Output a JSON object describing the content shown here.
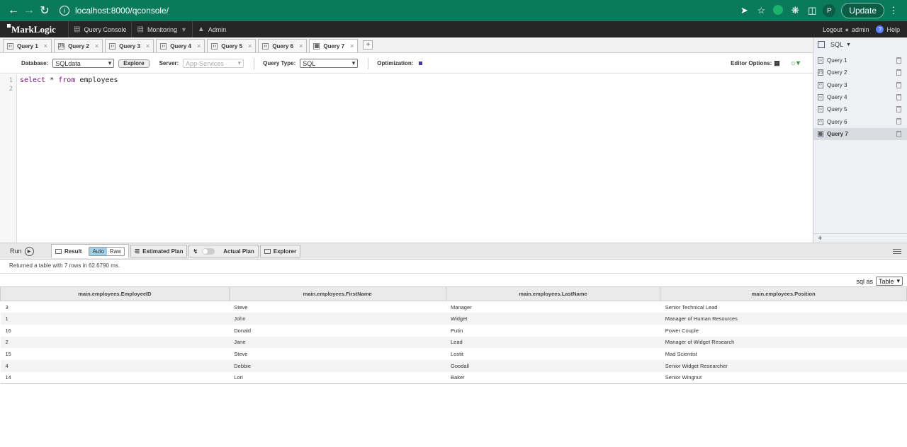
{
  "browser": {
    "url": "localhost:8000/qconsole/",
    "profile_initial": "P",
    "update_label": "Update"
  },
  "app": {
    "logo": "MarkLogic",
    "nav": [
      {
        "label": "Query Console",
        "icon": "console-icon"
      },
      {
        "label": "Monitoring",
        "icon": "monitor-icon"
      },
      {
        "label": "Admin",
        "icon": "admin-icon"
      }
    ],
    "logout": "Logout",
    "user": "admin",
    "help": "Help"
  },
  "tabs": [
    "Query 1",
    "Query 2",
    "Query 3",
    "Query 4",
    "Query 5",
    "Query 6",
    "Query 7"
  ],
  "toolbar": {
    "database_label": "Database:",
    "database_value": "SQLdata",
    "explore_label": "Explore",
    "server_label": "Server:",
    "server_value": "App-Services",
    "query_type_label": "Query Type:",
    "query_type_value": "SQL",
    "optimization_label": "Optimization:",
    "editor_options_label": "Editor Options:"
  },
  "editor": {
    "lines": [
      "1",
      "2"
    ],
    "kw1": "select",
    "op": "*",
    "kw2": "from",
    "ident": "employees"
  },
  "side": {
    "title": "SQL",
    "items": [
      "Query 1",
      "Query 2",
      "Query 3",
      "Query 4",
      "Query 5",
      "Query 6",
      "Query 7"
    ],
    "add": "+"
  },
  "results": {
    "run_label": "Run",
    "tab_result": "Result",
    "auto": "Auto",
    "raw": "Raw",
    "tab_estimated": "Estimated Plan",
    "tab_actual": "Actual Plan",
    "tab_explorer": "Explorer",
    "status": "Returned a table with 7 rows in 62.6790 ms.",
    "sql_as_label": "sql as",
    "sql_as_value": "Table",
    "columns": [
      "main.employees.EmployeeID",
      "main.employees.FirstName",
      "main.employees.LastName",
      "main.employees.Position"
    ],
    "rows": [
      [
        "3",
        "Steve",
        "Manager",
        "Senior Technical Lead"
      ],
      [
        "1",
        "John",
        "Widget",
        "Manager of Human Resources"
      ],
      [
        "16",
        "Donald",
        "Putin",
        "Power Couple"
      ],
      [
        "2",
        "Jane",
        "Lead",
        "Manager of Widget Research"
      ],
      [
        "15",
        "Steve",
        "Lostit",
        "Mad Scientist"
      ],
      [
        "4",
        "Debbie",
        "Goodall",
        "Senior Widget Researcher"
      ],
      [
        "14",
        "Lori",
        "Baker",
        "Senior Wingnut"
      ]
    ]
  }
}
